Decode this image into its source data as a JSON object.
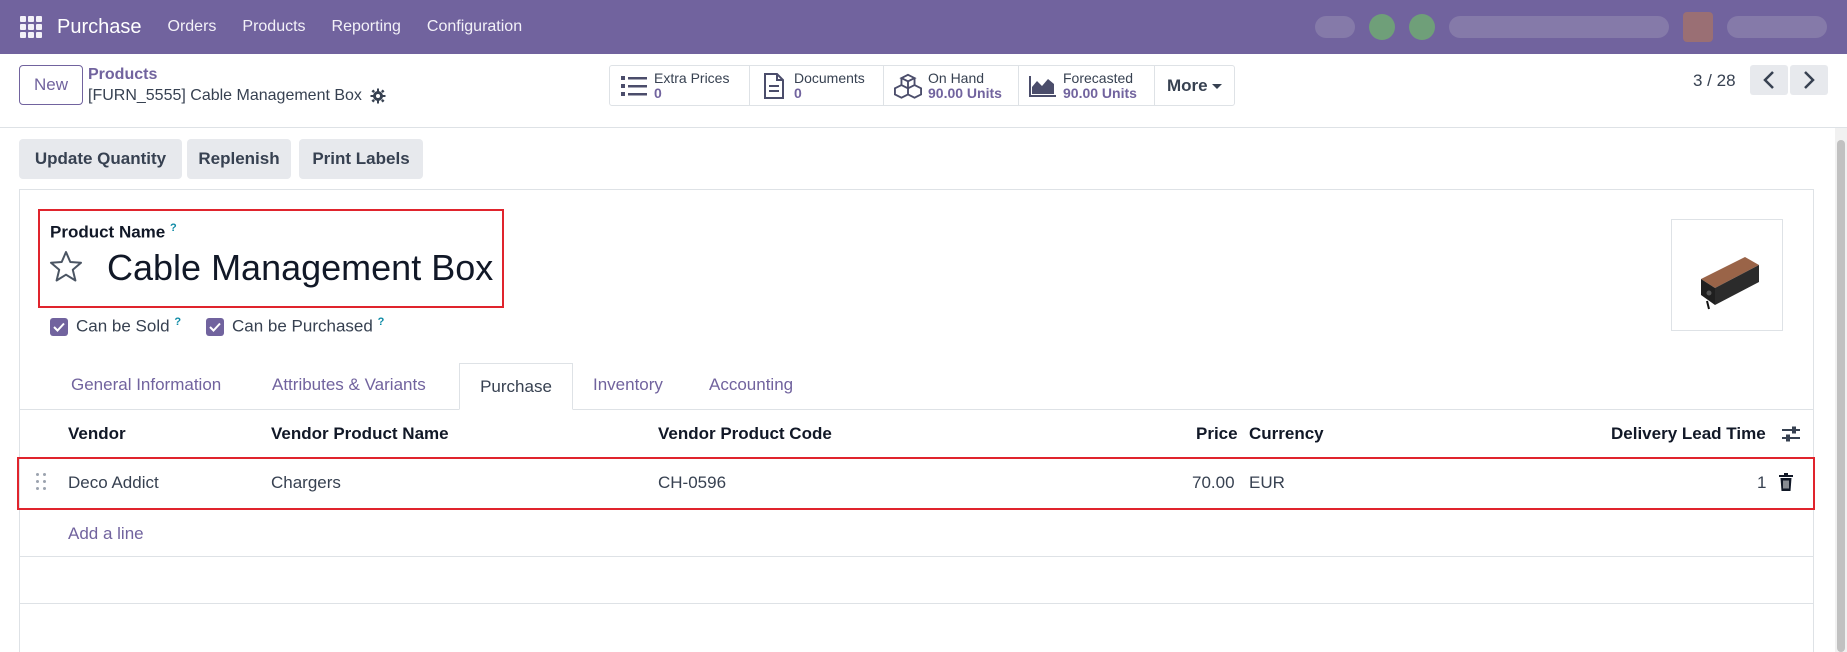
{
  "navbar": {
    "app_name": "Purchase",
    "menu": [
      "Orders",
      "Products",
      "Reporting",
      "Configuration"
    ],
    "color": "#71639e"
  },
  "control_panel": {
    "new_label": "New",
    "breadcrumb": "Products",
    "record_title": "[FURN_5555] Cable Management Box",
    "smart_buttons": [
      {
        "icon": "list-icon",
        "label": "Extra Prices",
        "value": "0"
      },
      {
        "icon": "document-icon",
        "label": "Documents",
        "value": "0"
      },
      {
        "icon": "cubes-icon",
        "label": "On Hand",
        "value": "90.00 Units"
      },
      {
        "icon": "area-chart-icon",
        "label": "Forecasted",
        "value": "90.00 Units"
      }
    ],
    "more_label": "More",
    "pager": "3 / 28"
  },
  "actions": [
    "Update Quantity",
    "Replenish",
    "Print Labels"
  ],
  "form": {
    "name_label": "Product Name",
    "help_mark": "?",
    "product_name": "Cable Management Box",
    "can_be_sold": "Can be Sold",
    "can_be_purchased": "Can be Purchased",
    "tabs": [
      "General Information",
      "Attributes & Variants",
      "Purchase",
      "Inventory",
      "Accounting"
    ],
    "active_tab": "Purchase"
  },
  "vendor_table": {
    "headers": [
      "Vendor",
      "Vendor Product Name",
      "Vendor Product Code",
      "Price",
      "Currency",
      "Delivery Lead Time"
    ],
    "rows": [
      {
        "vendor": "Deco Addict",
        "product_name": "Chargers",
        "product_code": "CH-0596",
        "price": "70.00",
        "currency": "EUR",
        "lead_time": "1"
      }
    ],
    "add_line": "Add a line"
  },
  "colors": {
    "accent": "#71639e",
    "highlight": "#e0242d",
    "help": "#0d8aa5"
  }
}
